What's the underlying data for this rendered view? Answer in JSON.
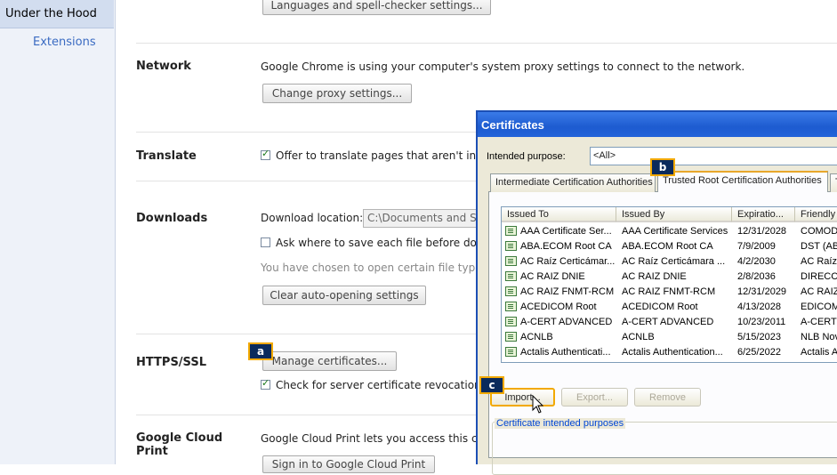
{
  "sidebar": {
    "selected": "Under the Hood",
    "items": [
      {
        "label": "Extensions"
      }
    ]
  },
  "settings": {
    "languages_button": "Languages and spell-checker settings...",
    "network": {
      "label": "Network",
      "desc": "Google Chrome is using your computer's system proxy settings to connect to the network.",
      "button": "Change proxy settings..."
    },
    "translate": {
      "label": "Translate",
      "checkbox": "Offer to translate pages that aren't in a",
      "checked": true
    },
    "downloads": {
      "label": "Downloads",
      "location_label": "Download location:",
      "location_value": "C:\\Documents and S",
      "ask_checkbox": "Ask where to save each file before dow",
      "ask_checked": false,
      "auto_open_note": "You have chosen to open certain file types",
      "clear_button": "Clear auto-opening settings"
    },
    "https": {
      "label": "HTTPS/SSL",
      "button": "Manage certificates...",
      "revocation_checkbox": "Check for server certificate revocation",
      "revocation_checked": true
    },
    "cloud_print": {
      "label_line1": "Google Cloud",
      "label_line2": "Print",
      "desc": "Google Cloud Print lets you access this c",
      "button": "Sign in to Google Cloud Print"
    }
  },
  "dialog": {
    "title": "Certificates",
    "intended_purpose_label": "Intended purpose:",
    "intended_purpose_value": "<All>",
    "tabs": [
      {
        "label": "Intermediate Certification Authorities"
      },
      {
        "label": "Trusted Root Certification Authorities"
      },
      {
        "label": "T"
      }
    ],
    "columns": [
      "Issued To",
      "Issued By",
      "Expiratio...",
      "Friendly"
    ],
    "rows": [
      [
        "AAA Certificate Ser...",
        "AAA Certificate Services",
        "12/31/2028",
        "COMODO"
      ],
      [
        "ABA.ECOM Root CA",
        "ABA.ECOM Root CA",
        "7/9/2009",
        "DST (ABA"
      ],
      [
        "AC Raíz Certicámar...",
        "AC Raíz Certicámara ...",
        "4/2/2030",
        "AC Raíz C"
      ],
      [
        "AC RAIZ DNIE",
        "AC RAIZ DNIE",
        "2/8/2036",
        "DIRECCI"
      ],
      [
        "AC RAIZ FNMT-RCM",
        "AC RAIZ FNMT-RCM",
        "12/31/2029",
        "AC RAIZ"
      ],
      [
        "ACEDICOM Root",
        "ACEDICOM Root",
        "4/13/2028",
        "EDICOM"
      ],
      [
        "A-CERT ADVANCED",
        "A-CERT ADVANCED",
        "10/23/2011",
        "A-CERT A"
      ],
      [
        "ACNLB",
        "ACNLB",
        "5/15/2023",
        "NLB Nova"
      ],
      [
        "Actalis Authenticati...",
        "Actalis Authentication...",
        "6/25/2022",
        "Actalis Au"
      ]
    ],
    "buttons": {
      "import": "Import...",
      "export": "Export...",
      "remove": "Remove"
    },
    "group_legend": "Certificate intended purposes"
  },
  "callouts": {
    "a": "a",
    "b": "b",
    "c": "c"
  },
  "colors": {
    "titlebar": "#1d5bd0",
    "callout_bg": "#0a2a5c",
    "callout_border": "#f2a900",
    "link": "#3a6bc2"
  }
}
